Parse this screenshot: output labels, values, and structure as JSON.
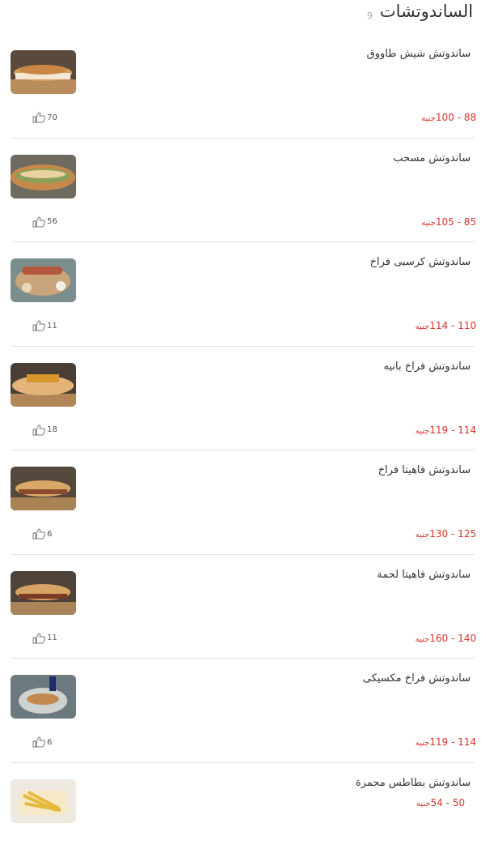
{
  "header": {
    "title": "الساندوتشات",
    "count": "9"
  },
  "currency": "جنيه",
  "items": [
    {
      "name": "ساندوتش شيش طاووق",
      "price": "88 - 100",
      "likes": "70",
      "image": "sandwich-photo"
    },
    {
      "name": "ساندوتش مسحب",
      "price": "85 - 105",
      "likes": "56",
      "image": "sandwich-photo"
    },
    {
      "name": "ساندوتش كرسبى فراخ",
      "price": "110 - 114",
      "likes": "11",
      "image": "sandwich-photo"
    },
    {
      "name": "ساندوتش فراخ بانيه",
      "price": "114 - 119",
      "likes": "18",
      "image": "sandwich-photo"
    },
    {
      "name": "ساندوتش فاهيتا فراخ",
      "price": "125 - 130",
      "likes": "6",
      "image": "sandwich-photo"
    },
    {
      "name": "ساندوتش فاهيتا لحمة",
      "price": "140 - 160",
      "likes": "11",
      "image": "sandwich-photo"
    },
    {
      "name": "ساندوتش فراخ مكسيكى",
      "price": "114 - 119",
      "likes": "6",
      "image": "sandwich-photo"
    },
    {
      "name": "ساندوتش بطاطس محمرة",
      "price": "50 - 54",
      "likes": "",
      "image": "fries-photo"
    }
  ]
}
